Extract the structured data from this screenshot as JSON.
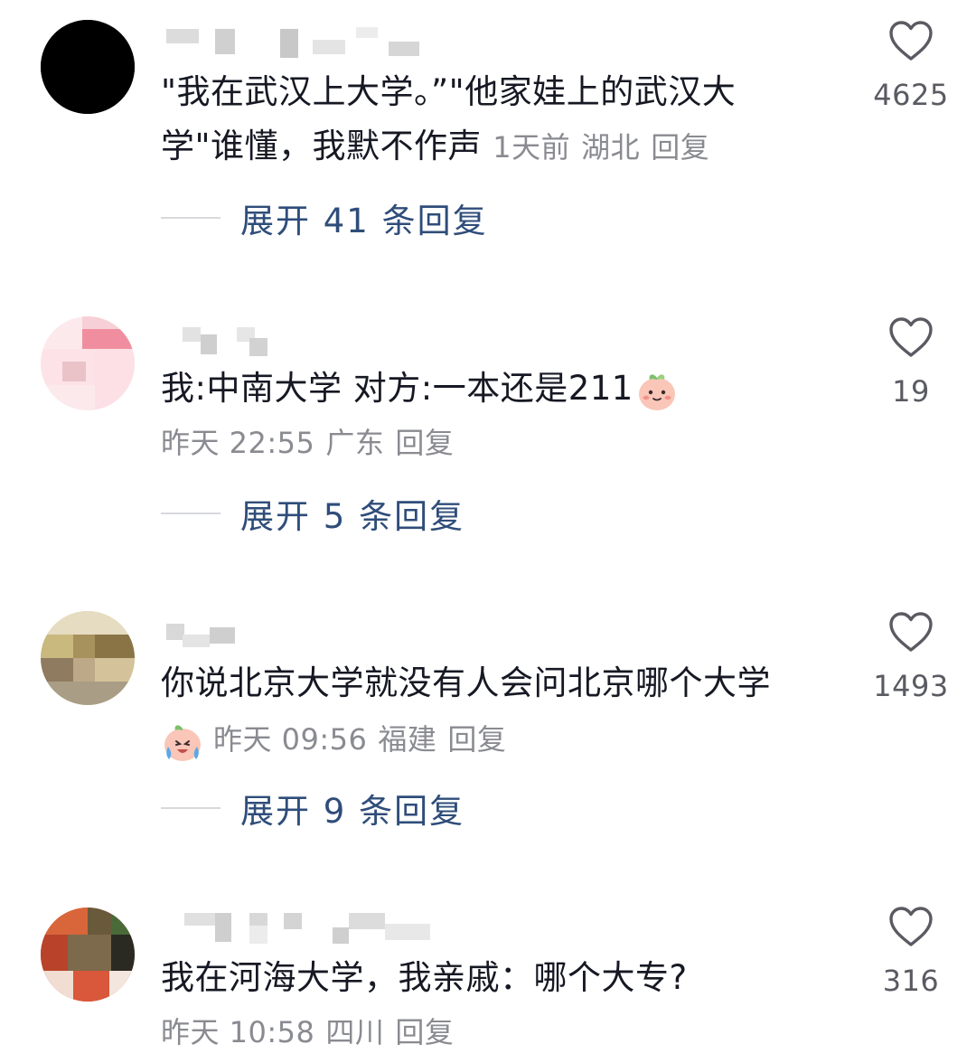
{
  "comments": [
    {
      "text": "\"我在武汉上大学。”\"他家娃上的武汉大学\"谁懂，我默不作声",
      "time": "1天前",
      "location": "湖北",
      "reply_label": "回复",
      "expand_label": "展开 41 条回复",
      "likes": "4625"
    },
    {
      "text": "我:中南大学 对方:一本还是211",
      "time": "昨天 22:55",
      "location": "广东",
      "reply_label": "回复",
      "expand_label": "展开 5 条回复",
      "likes": "19"
    },
    {
      "text": "你说北京大学就没有人会问北京哪个大学",
      "time": "昨天 09:56",
      "location": "福建",
      "reply_label": "回复",
      "expand_label": "展开 9 条回复",
      "likes": "1493"
    },
    {
      "text": "我在河海大学，我亲戚：哪个大专?",
      "time": "昨天 10:58",
      "location": "四川",
      "reply_label": "回复",
      "likes": "316"
    }
  ],
  "colors": {
    "text": "#161823",
    "meta": "#8a8b91",
    "expand_link": "#2f4d7a",
    "heart_outline": "#5a5b62"
  },
  "icons": {
    "like": "heart-outline-icon",
    "emoji_smile": "peach-smile-emoji-icon",
    "emoji_cry": "peach-crying-emoji-icon"
  }
}
